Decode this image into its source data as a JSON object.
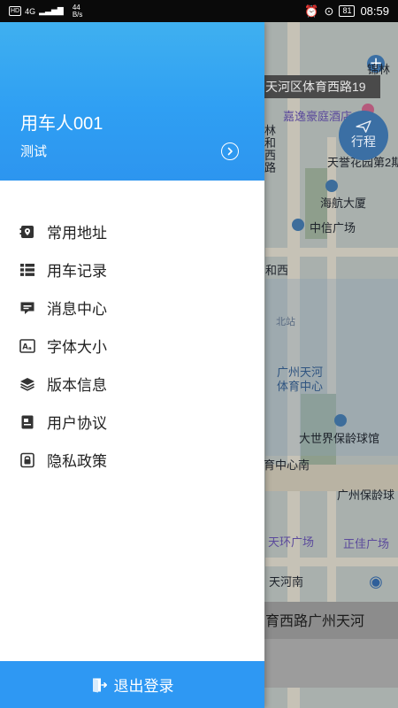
{
  "status_bar": {
    "left_badge": "HD",
    "network": "4G",
    "speed_value": "44",
    "speed_unit": "B/s",
    "battery": "81",
    "time": "08:59"
  },
  "map": {
    "banner_text": "天河区体育西路19",
    "bottom_text": "育西路广州天河",
    "trip_button_label": "行程",
    "labels": [
      {
        "text": "锦林"
      },
      {
        "text": "嘉逸豪庭酒店"
      },
      {
        "text": "林和西路"
      },
      {
        "text": "天誉花园第2期"
      },
      {
        "text": "海航大厦"
      },
      {
        "text": "中信广场"
      },
      {
        "text": "和西"
      },
      {
        "text": "北站"
      },
      {
        "text": "广州天河体育中心"
      },
      {
        "text": "大世界保龄球馆"
      },
      {
        "text": "育中心南"
      },
      {
        "text": "广州保龄球"
      },
      {
        "text": "天环广场"
      },
      {
        "text": "正佳广场"
      },
      {
        "text": "天河南"
      }
    ]
  },
  "drawer": {
    "user_name": "用车人001",
    "user_subtitle": "测试",
    "menu_items": [
      {
        "label": "常用地址",
        "icon": "address-book-icon"
      },
      {
        "label": "用车记录",
        "icon": "list-icon"
      },
      {
        "label": "消息中心",
        "icon": "message-icon"
      },
      {
        "label": "字体大小",
        "icon": "font-size-icon"
      },
      {
        "label": "版本信息",
        "icon": "layers-icon"
      },
      {
        "label": "用户协议",
        "icon": "document-icon"
      },
      {
        "label": "隐私政策",
        "icon": "privacy-lock-icon"
      }
    ],
    "logout_label": "退出登录"
  },
  "colors": {
    "header_blue": "#2f9ff3",
    "logout_blue": "#2e98f3",
    "menu_icon": "#333333"
  }
}
